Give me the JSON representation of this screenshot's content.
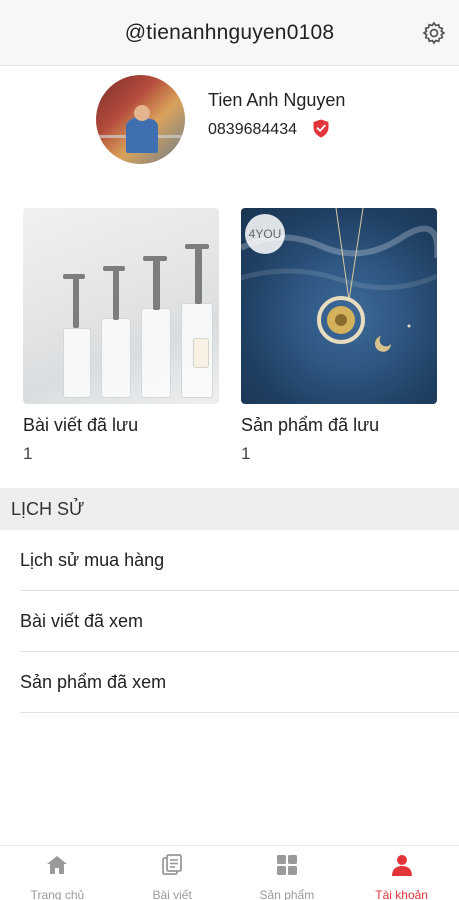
{
  "header": {
    "title": "@tienanhnguyen0108",
    "settings_icon": "gear-icon"
  },
  "profile": {
    "name": "Tien Anh Nguyen",
    "phone": "0839684434",
    "verified_icon": "shield-check-icon",
    "verified_color": "#e2353a"
  },
  "saved": [
    {
      "label": "Bài viết đã lưu",
      "count": "1"
    },
    {
      "label": "Sản phẩm đã lưu",
      "count": "1",
      "image_badge": "4YOU"
    }
  ],
  "history": {
    "section_title": "LỊCH SỬ",
    "items": [
      {
        "label": "Lịch sử mua hàng"
      },
      {
        "label": "Bài viết đã xem"
      },
      {
        "label": "Sản phẩm đã xem"
      }
    ]
  },
  "tabbar": {
    "active_color": "#e2353a",
    "inactive_color": "#9a9a9a",
    "tabs": [
      {
        "label": "Trang chủ",
        "icon": "home-icon",
        "active": false
      },
      {
        "label": "Bài viết",
        "icon": "articles-icon",
        "active": false
      },
      {
        "label": "Sản phẩm",
        "icon": "grid-icon",
        "active": false
      },
      {
        "label": "Tài khoản",
        "icon": "person-icon",
        "active": true
      }
    ]
  }
}
